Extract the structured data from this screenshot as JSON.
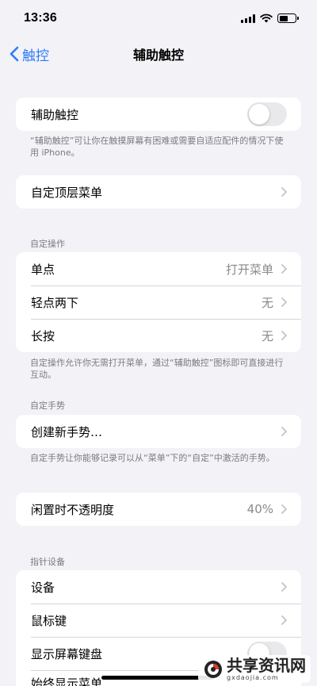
{
  "status_bar": {
    "time": "13:36",
    "battery_level": 0.55
  },
  "nav": {
    "back_label": "触控",
    "title": "辅助触控"
  },
  "assistive_touch": {
    "label": "辅助触控",
    "enabled": false
  },
  "assistive_touch_note": "“辅助触控”可让你在触摸屏幕有困难或需要自适应配件的情况下使用 iPhone。",
  "top_menu": {
    "label": "自定顶层菜单"
  },
  "custom_actions": {
    "header": "自定操作",
    "rows": [
      {
        "label": "单点",
        "value": "打开菜单"
      },
      {
        "label": "轻点两下",
        "value": "无"
      },
      {
        "label": "长按",
        "value": "无"
      }
    ],
    "note": "自定操作允许你无需打开菜单，通过“辅助触控”图标即可直接进行互动。"
  },
  "custom_gestures": {
    "header": "自定手势",
    "create_label": "创建新手势…",
    "note": "自定手势让你能够记录可以从“菜单”下的“自定”中激活的手势。"
  },
  "idle_opacity": {
    "label": "闲置时不透明度",
    "value": "40%"
  },
  "pointer_devices": {
    "header": "指针设备",
    "rows": [
      {
        "label": "设备"
      },
      {
        "label": "鼠标键"
      },
      {
        "label": "显示屏幕键盘"
      },
      {
        "label": "始终显示菜单"
      }
    ]
  },
  "watermark": {
    "title": "共享资讯网",
    "subtitle": "gxdaojia.com"
  }
}
